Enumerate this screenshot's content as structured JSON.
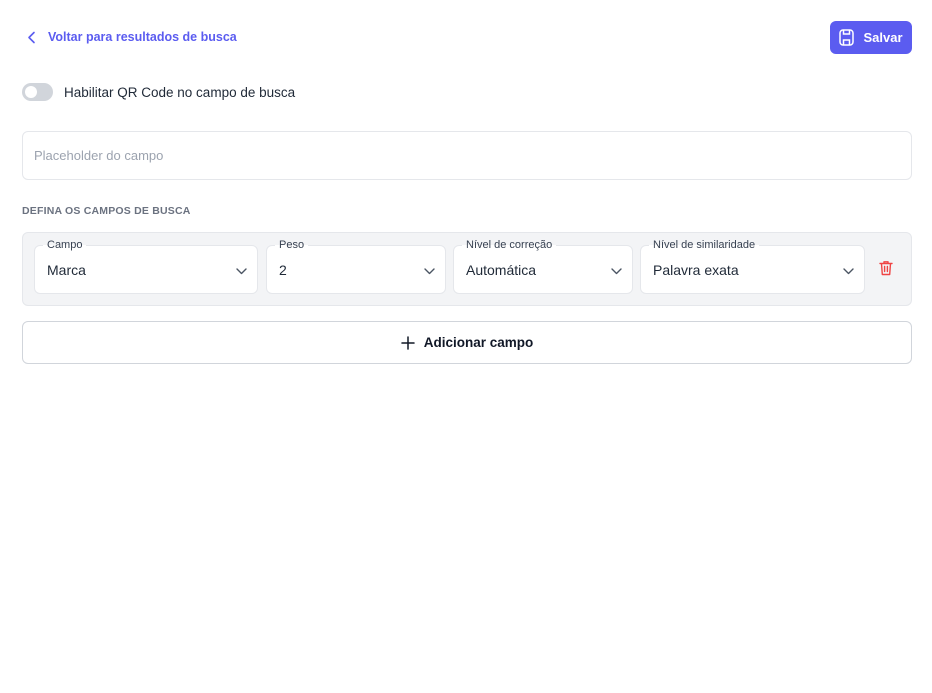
{
  "header": {
    "back_label": "Voltar para resultados de busca",
    "save_label": "Salvar"
  },
  "qr_toggle": {
    "label": "Habilitar QR Code no campo de busca",
    "enabled": false
  },
  "placeholder_field": {
    "value": "",
    "placeholder": "Placeholder do campo"
  },
  "section": {
    "title": "DEFINA OS CAMPOS DE BUSCA"
  },
  "search_fields": [
    {
      "campo": {
        "label": "Campo",
        "value": "Marca"
      },
      "peso": {
        "label": "Peso",
        "value": "2"
      },
      "correcao": {
        "label": "Nível de correção",
        "value": "Automática"
      },
      "similaridade": {
        "label": "Nível de similaridade",
        "value": "Palavra exata"
      }
    }
  ],
  "add_field": {
    "label": "Adicionar campo"
  },
  "colors": {
    "accent": "#5b5cf0",
    "danger": "#ef4444",
    "panel_bg": "#f3f4f6"
  },
  "icons": {
    "back": "chevron-left-icon",
    "save": "save-icon",
    "select": "chevron-down-icon",
    "delete": "trash-icon",
    "add": "plus-icon"
  }
}
